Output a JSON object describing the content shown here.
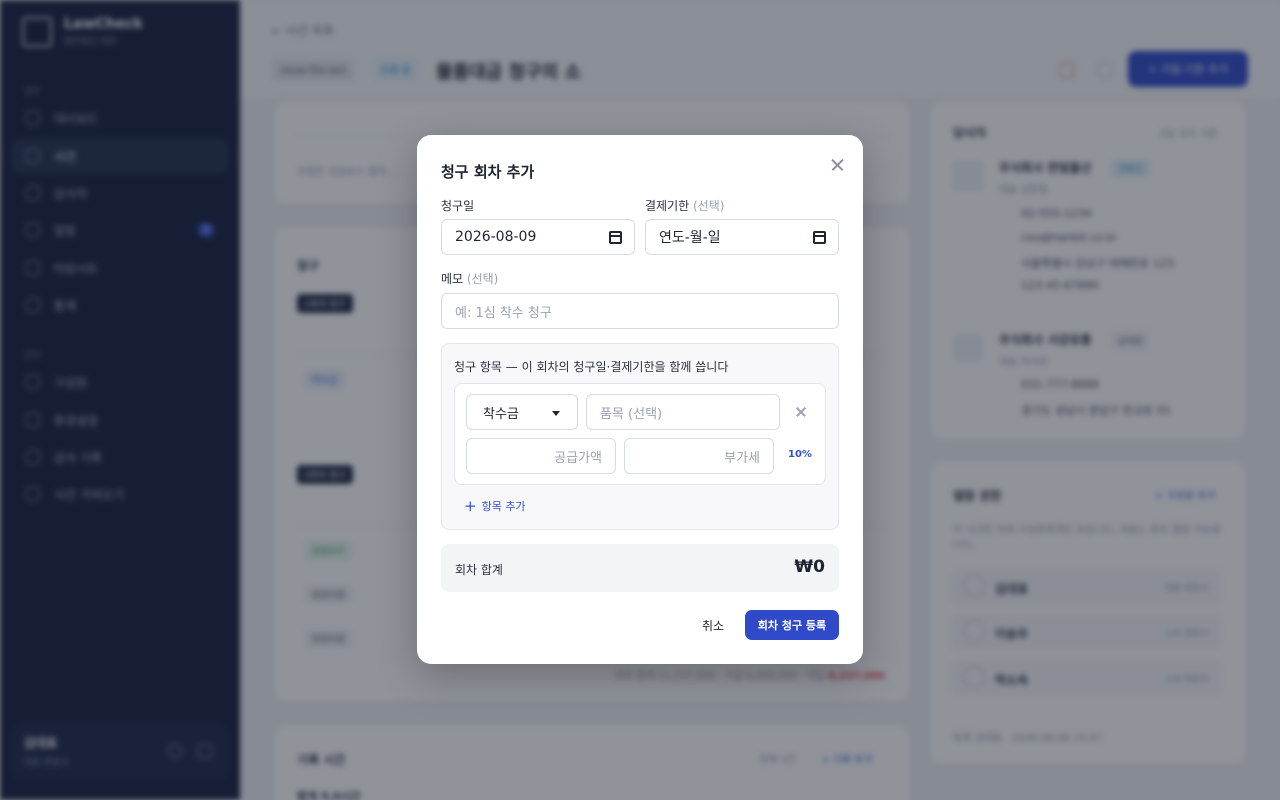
{
  "sidebar": {
    "brand_name": "LawCheck",
    "brand_sub": "법무법인 데모",
    "group_work": "업무",
    "group_settings": "관리",
    "items": [
      {
        "label": "대시보드"
      },
      {
        "label": "사건"
      },
      {
        "label": "당사자"
      },
      {
        "label": "알림",
        "badge": "3"
      },
      {
        "label": "타임시트"
      },
      {
        "label": "통계"
      },
      {
        "label": "구성원"
      },
      {
        "label": "환경설정"
      },
      {
        "label": "감사 기록"
      },
      {
        "label": "사건 가져오기"
      }
    ],
    "user": {
      "name": "김대표",
      "role": "대표 변호사"
    }
  },
  "topbar": {
    "back": "← 사건 목록",
    "case_no": "2026-민0-001",
    "status": "진행 중",
    "title": "물품대금 청구의 소",
    "add_date_button": "+ 기일·기한 추가"
  },
  "background": {
    "billing_title": "청구",
    "round1": "1회차 청구",
    "round2": "2회차 청구",
    "label_fee": "착수금",
    "label_success": "성공보수",
    "label_expense": "법정비용",
    "billing_footer": "회차 합계 11,237,000 · 수납 6,000,000 · 미납 ",
    "billing_unpaid": "6,237,000",
    "note_text": "조정은 성공보수 협의...",
    "time_title": "기록 시간",
    "time_summary": "전체 5건",
    "time_add": "+ 기록 추가",
    "time_total_label": "합계 9.0시간",
    "parties_title": "당사자",
    "parties_meta": "2일 사이 기준",
    "party1": {
      "name": "주식회사 한빛물산",
      "tag": "의뢰인",
      "rep": "대표 김한빛",
      "phone": "02-555-1234",
      "email": "ceo@hanbit.co.kr",
      "address": "서울특별시 강남구 테헤란로 123",
      "biz_no": "123-45-67890"
    },
    "party2": {
      "name": "주식회사 서강유통",
      "tag": "상대방",
      "rep": "대표 이서강",
      "phone": "031-777-8888",
      "address": "경기도 성남시 분당구 판교로 55"
    },
    "team_title": "열람 권한",
    "team_add": "+ 구성원 추가",
    "team_desc": "이 사건은 아래 구성원에게만 보입니다. 대표는 항상 열람 가능합니다.",
    "members": [
      {
        "name": "김대표",
        "role": "대표 변호사"
      },
      {
        "name": "이송우",
        "role": "소속 변호사"
      },
      {
        "name": "박소속",
        "role": "소속 변호사"
      }
    ],
    "created_text": "등록 김대표 · 2026-08-08 15:07"
  },
  "modal": {
    "title": "청구 회차 추가",
    "billing_date_label": "청구일",
    "billing_date_value": "2026-08-09",
    "due_date_label": "결제기한",
    "optional_suffix": "(선택)",
    "due_date_value": "연도-월-일",
    "memo_label": "메모",
    "memo_placeholder": "예: 1심 착수 청구",
    "items_hint": "청구 항목 — 이 회차의 청구일·결제기한을 함께 씁니다",
    "item_type": "착수금",
    "item_name_placeholder": "품목 (선택)",
    "supply_placeholder": "공급가액",
    "vat_placeholder": "부가세",
    "vat_rate": "10%",
    "add_item": "항목 추가",
    "total_label": "회차 합계",
    "total_value": "₩0",
    "cancel": "취소",
    "submit": "회차 청구 등록"
  }
}
